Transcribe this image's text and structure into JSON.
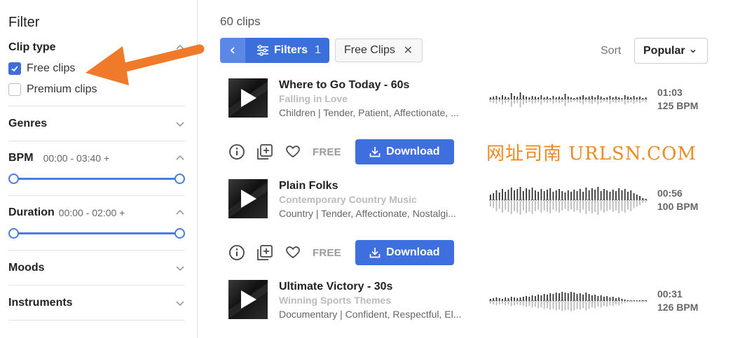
{
  "sidebar": {
    "title": "Filter",
    "clip_type": {
      "title": "Clip type",
      "options": [
        {
          "label": "Free clips",
          "checked": true
        },
        {
          "label": "Premium clips",
          "checked": false
        }
      ]
    },
    "genres": {
      "title": "Genres"
    },
    "bpm": {
      "title": "BPM",
      "range": "00:00 - 03:40 +",
      "low": 0,
      "high": 1
    },
    "duration": {
      "title": "Duration",
      "range": "00:00 - 02:00 +",
      "low": 0,
      "high": 1
    },
    "moods": {
      "title": "Moods"
    },
    "instruments": {
      "title": "Instruments"
    }
  },
  "main": {
    "clip_count": "60 clips",
    "filters_button": {
      "label": "Filters",
      "count": "1"
    },
    "active_chip": {
      "label": "Free Clips"
    },
    "sort": {
      "label": "Sort",
      "value": "Popular"
    }
  },
  "tracks": [
    {
      "title": "Where to Go Today - 60s",
      "album": "Falling in Love",
      "tags": "Children | Tender, Patient, Affectionate, ...",
      "duration": "01:03",
      "bpm": "125 BPM"
    },
    {
      "title": "Plain Folks",
      "album": "Contemporary Country Music",
      "tags": "Country | Tender, Affectionate, Nostalgi...",
      "duration": "00:56",
      "bpm": "100 BPM"
    },
    {
      "title": "Ultimate Victory - 30s",
      "album": "Winning Sports Themes",
      "tags": "Documentary | Confident, Respectful, El...",
      "duration": "00:31",
      "bpm": "126 BPM"
    }
  ],
  "actions": {
    "free_label": "FREE",
    "download_label": "Download"
  },
  "watermark": "网址司南 URLSN.COM",
  "colors": {
    "accent": "#3f6fde",
    "watermark": "#f08a1f",
    "arrow": "#f07a2a"
  }
}
